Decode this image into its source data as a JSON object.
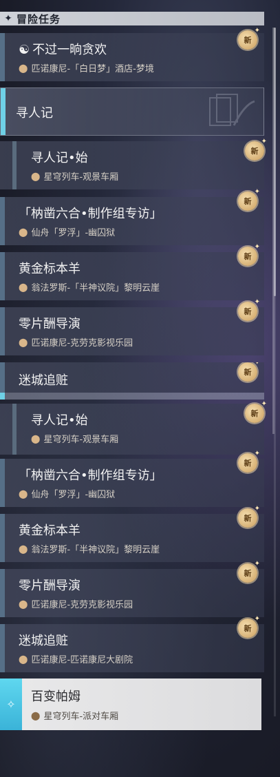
{
  "header": {
    "title": "冒险任务",
    "icon": "diamond-star-icon"
  },
  "quests": {
    "top": {
      "title": "不过一晌贪欢",
      "location": "匹诺康尼-「白日梦」酒店-梦境",
      "badge": "新"
    },
    "section_label": "寻人记",
    "list_a": [
      {
        "title": "寻人记•始",
        "location": "星穹列车-观景车厢",
        "badge": "新"
      },
      {
        "title": "「枘凿六合•制作组专访」",
        "location": "仙舟「罗浮」-幽囚狱",
        "badge": "新"
      },
      {
        "title": "黄金标本羊",
        "location": "翁法罗斯-「半神议院」黎明云崖",
        "badge": "新"
      },
      {
        "title": "零片酬导演",
        "location": "匹诺康尼-克劳克影视乐园",
        "badge": "新"
      },
      {
        "title": "迷城追赃",
        "badge": "新"
      }
    ],
    "list_b": [
      {
        "title": "寻人记•始",
        "location": "星穹列车-观景车厢",
        "badge": "新"
      },
      {
        "title": "「枘凿六合•制作组专访」",
        "location": "仙舟「罗浮」-幽囚狱",
        "badge": "新"
      },
      {
        "title": "黄金标本羊",
        "location": "翁法罗斯-「半神议院」黎明云崖",
        "badge": "新"
      },
      {
        "title": "零片酬导演",
        "location": "匹诺康尼-克劳克影视乐园",
        "badge": "新"
      },
      {
        "title": "迷城追赃",
        "location": "匹诺康尼-匹诺康尼大剧院",
        "badge": "新"
      }
    ],
    "selected": {
      "title": "百变帕姆",
      "location": "星穹列车-派对车厢"
    }
  },
  "colors": {
    "accent_cyan": "#5fd7ef",
    "badge_gold": "#c99c5b",
    "card_dark": "#3b4055"
  }
}
